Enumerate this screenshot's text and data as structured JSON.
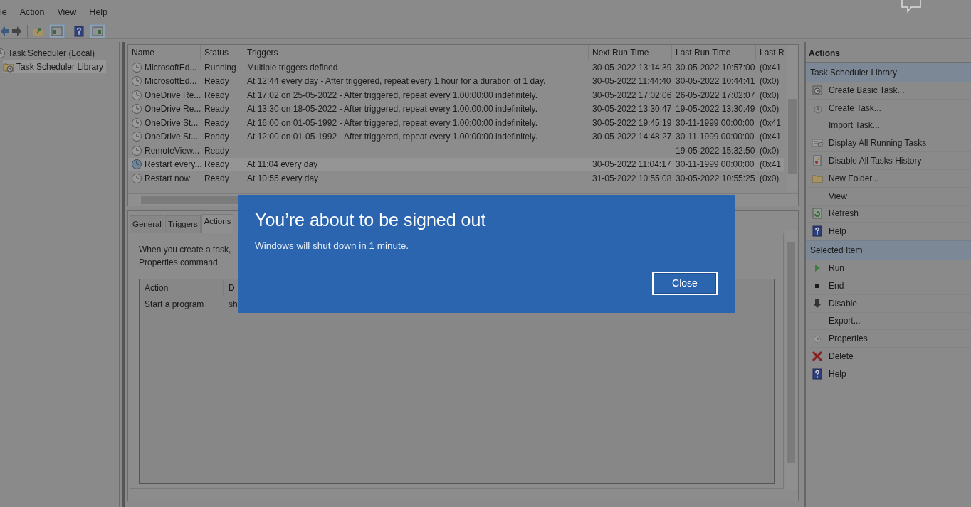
{
  "menu": [
    "le",
    "Action",
    "View",
    "Help"
  ],
  "tree": [
    {
      "label": "Task Scheduler (Local)",
      "selected": false,
      "children": [
        {
          "label": "Task Scheduler Library",
          "selected": true
        }
      ]
    }
  ],
  "task_table": {
    "columns": [
      "Name",
      "Status",
      "Triggers",
      "Next Run Time",
      "Last Run Time",
      "Last R"
    ],
    "rows": [
      {
        "cells": [
          "MicrosoftEd...",
          "Running",
          "Multiple triggers defined",
          "30-05-2022 13:14:39",
          "30-05-2022 10:57:00",
          "(0x41"
        ],
        "selected": false
      },
      {
        "cells": [
          "MicrosoftEd...",
          "Ready",
          "At 12:44 every day - After triggered, repeat every 1 hour for a duration of 1 day.",
          "30-05-2022 11:44:40",
          "30-05-2022 10:44:41",
          "(0x0)"
        ],
        "selected": false
      },
      {
        "cells": [
          "OneDrive Re...",
          "Ready",
          "At 17:02 on 25-05-2022 - After triggered, repeat every 1.00:00:00 indefinitely.",
          "30-05-2022 17:02:06",
          "26-05-2022 17:02:07",
          "(0x0)"
        ],
        "selected": false
      },
      {
        "cells": [
          "OneDrive Re...",
          "Ready",
          "At 13:30 on 18-05-2022 - After triggered, repeat every 1.00:00:00 indefinitely.",
          "30-05-2022 13:30:47",
          "19-05-2022 13:30:49",
          "(0x0)"
        ],
        "selected": false
      },
      {
        "cells": [
          "OneDrive St...",
          "Ready",
          "At 16:00 on 01-05-1992 - After triggered, repeat every 1.00:00:00 indefinitely.",
          "30-05-2022 19:45:19",
          "30-11-1999 00:00:00",
          "(0x41"
        ],
        "selected": false
      },
      {
        "cells": [
          "OneDrive St...",
          "Ready",
          "At 12:00 on 01-05-1992 - After triggered, repeat every 1.00:00:00 indefinitely.",
          "30-05-2022 14:48:27",
          "30-11-1999 00:00:00",
          "(0x41"
        ],
        "selected": false
      },
      {
        "cells": [
          "RemoteView...",
          "Ready",
          "",
          "",
          "19-05-2022 15:32:50",
          "(0x0)"
        ],
        "selected": false
      },
      {
        "cells": [
          "Restart every...",
          "Ready",
          "At 11:04 every day",
          "30-05-2022 11:04:17",
          "30-11-1999 00:00:00",
          "(0x41"
        ],
        "selected": true
      },
      {
        "cells": [
          "Restart now",
          "Ready",
          "At 10:55 every day",
          "31-05-2022 10:55:08",
          "30-05-2022 10:55:25",
          "(0x0)"
        ],
        "selected": false
      }
    ]
  },
  "detail": {
    "tabs": [
      {
        "label": "General",
        "selected": false
      },
      {
        "label": "Triggers",
        "selected": false
      },
      {
        "label": "Actions",
        "selected": true
      }
    ],
    "description": [
      "When you create a task,",
      "Properties command."
    ],
    "columns": [
      "Action",
      "D"
    ],
    "rows": [
      [
        "Start a program",
        "sh"
      ]
    ]
  },
  "actions_panel": {
    "title": "Actions",
    "sections": [
      {
        "title": "Task Scheduler Library",
        "items": [
          "Create Basic Task...",
          "Create Task...",
          "Import Task...",
          "Display All Running Tasks",
          "Disable All Tasks History",
          "New Folder...",
          "View",
          "Refresh",
          "Help"
        ]
      },
      {
        "title": "Selected Item",
        "items": [
          "Run",
          "End",
          "Disable",
          "Export...",
          "Properties",
          "Delete",
          "Help"
        ]
      }
    ]
  },
  "dialog": {
    "title": "You’re about to be signed out",
    "message": "Windows will shut down in 1 minute.",
    "button": "Close"
  }
}
